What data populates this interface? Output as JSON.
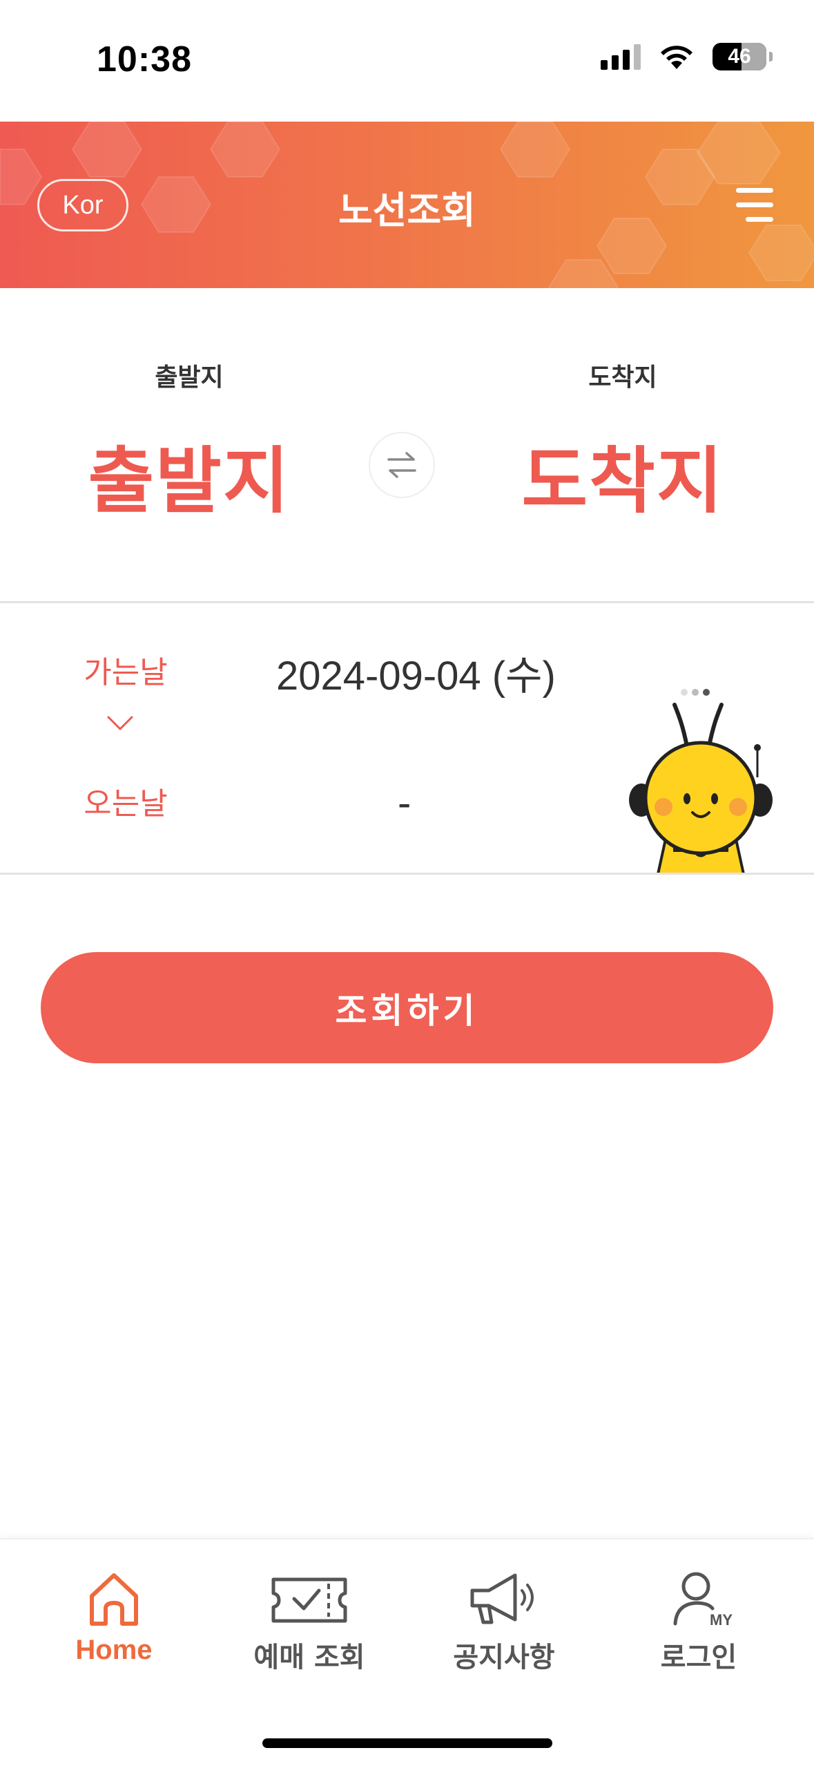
{
  "status_bar": {
    "time": "10:38",
    "battery": "46"
  },
  "header": {
    "language_label": "Kor",
    "title": "노선조회"
  },
  "route": {
    "departure": {
      "caption": "출발지",
      "value": "출발지"
    },
    "arrival": {
      "caption": "도착지",
      "value": "도착지"
    }
  },
  "dates": {
    "depart_label": "가는날",
    "depart_value": "2024-09-04 (수)",
    "return_label": "오는날",
    "return_value": "-"
  },
  "search_button": "조회하기",
  "tabbar": {
    "items": [
      {
        "label": "Home",
        "icon": "home-icon",
        "active": true
      },
      {
        "label": "예매 조회",
        "icon": "ticket-icon",
        "active": false
      },
      {
        "label": "공지사항",
        "icon": "megaphone-icon",
        "active": false
      },
      {
        "label": "로그인",
        "icon": "user-my-icon",
        "active": false
      }
    ]
  },
  "colors": {
    "accent": "#ee5a50",
    "header_start": "#ef5a52",
    "header_end": "#f0973f",
    "tab_active": "#ee6a3c"
  }
}
